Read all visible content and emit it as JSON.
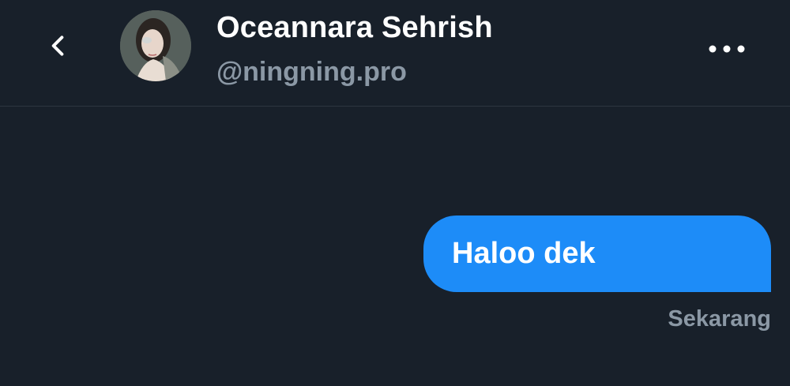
{
  "header": {
    "back_icon": "chevron-left-icon",
    "avatar_alt": "profile photo",
    "name": "Oceannara Sehrish",
    "handle": "@ningning.pro",
    "more_icon": "more-horizontal-icon"
  },
  "messages": [
    {
      "text": "Haloo dek",
      "direction": "outgoing",
      "time": "Sekarang"
    }
  ],
  "colors": {
    "background": "#18202a",
    "bubble": "#1d8cf8",
    "muted_text": "#8b98a5",
    "divider": "#2d3640"
  }
}
